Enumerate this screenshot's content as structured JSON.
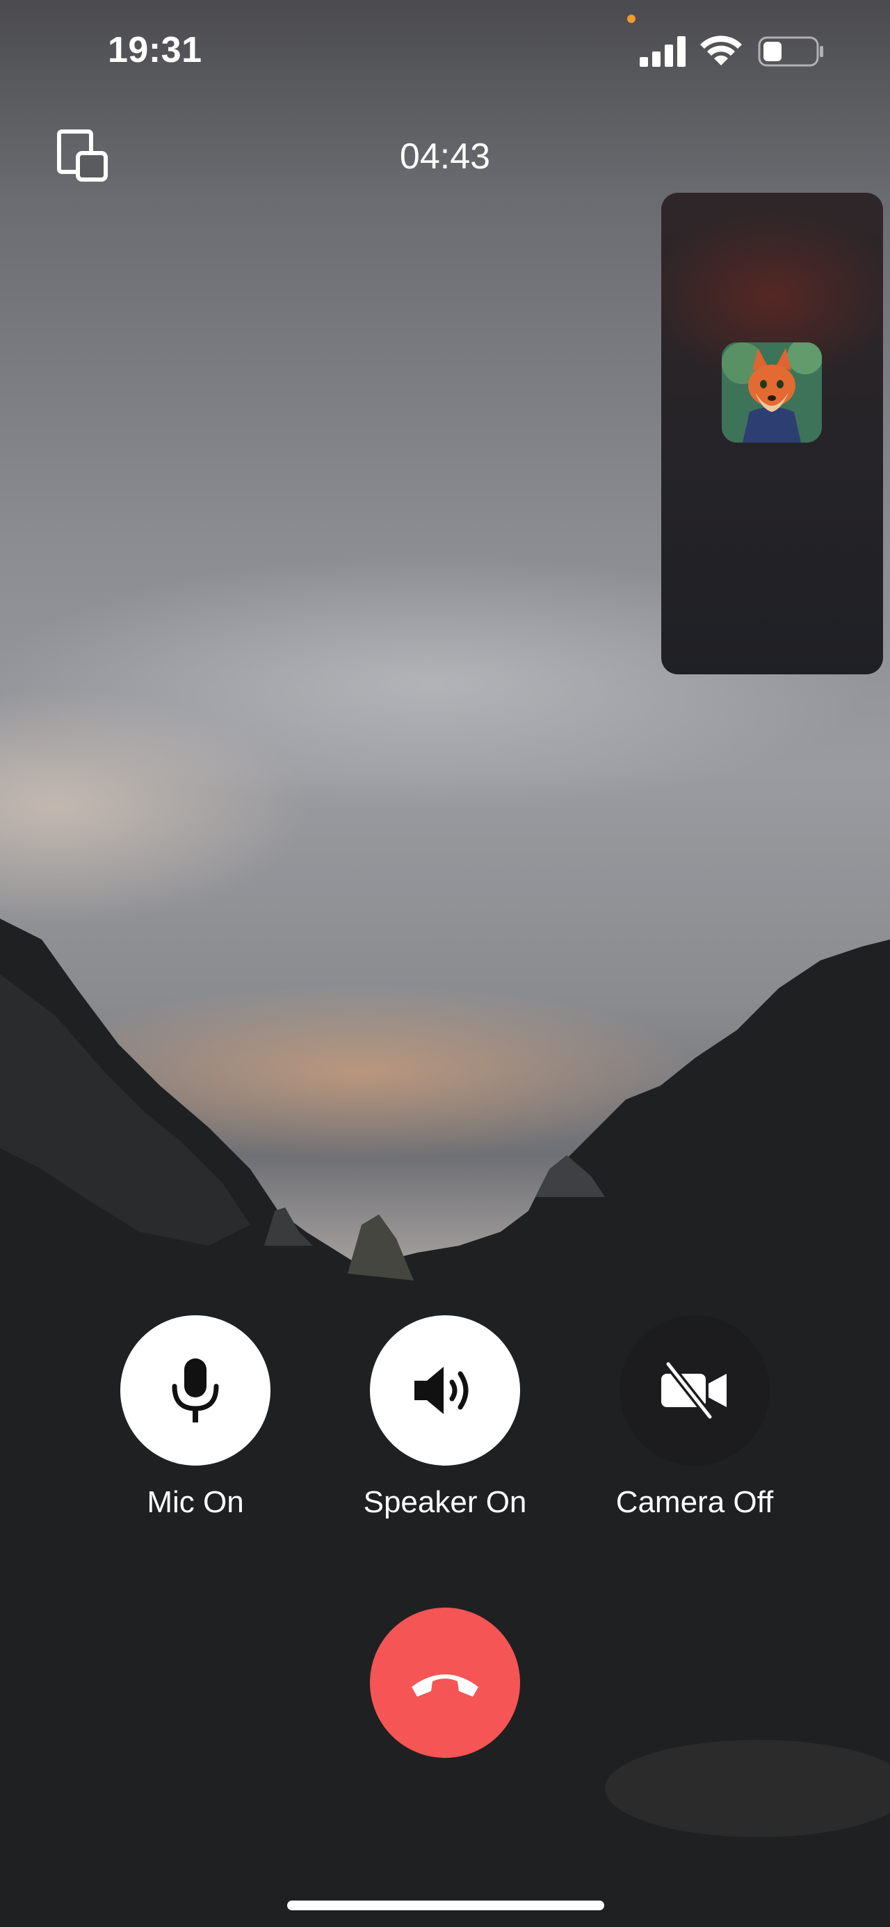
{
  "status_bar": {
    "time": "19:31",
    "recording_dot_color": "#f29a2a",
    "signal_icon": "cellular-signal-icon",
    "wifi_icon": "wifi-icon",
    "battery_icon": "battery-low-icon",
    "battery_level": 0.3
  },
  "header": {
    "switch_icon": "switch-view-icon",
    "call_duration": "04:43"
  },
  "pip": {
    "avatar_icon": "fox-avatar-icon"
  },
  "controls": {
    "mic": {
      "label": "Mic On",
      "icon": "microphone-icon",
      "state": "on"
    },
    "speaker": {
      "label": "Speaker On",
      "icon": "speaker-icon",
      "state": "on"
    },
    "camera": {
      "label": "Camera Off",
      "icon": "camera-off-icon",
      "state": "off"
    }
  },
  "hangup": {
    "icon": "hang-up-icon",
    "color": "#f55555"
  }
}
